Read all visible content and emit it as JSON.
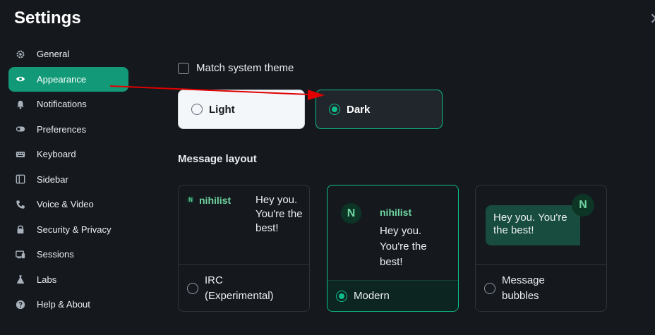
{
  "title": "Settings",
  "close_icon": "close-icon",
  "sidebar": {
    "items": [
      {
        "label": "General",
        "icon": "gear-icon"
      },
      {
        "label": "Appearance",
        "icon": "eye-icon",
        "active": true
      },
      {
        "label": "Notifications",
        "icon": "bell-icon"
      },
      {
        "label": "Preferences",
        "icon": "toggle-icon"
      },
      {
        "label": "Keyboard",
        "icon": "keyboard-icon"
      },
      {
        "label": "Sidebar",
        "icon": "sidebar-icon"
      },
      {
        "label": "Voice & Video",
        "icon": "phone-icon"
      },
      {
        "label": "Security & Privacy",
        "icon": "lock-icon"
      },
      {
        "label": "Sessions",
        "icon": "devices-icon"
      },
      {
        "label": "Labs",
        "icon": "flask-icon"
      },
      {
        "label": "Help & About",
        "icon": "help-icon"
      }
    ]
  },
  "appearance": {
    "match_system_theme": {
      "label": "Match system theme",
      "checked": false
    },
    "themes": [
      {
        "label": "Light",
        "selected": false
      },
      {
        "label": "Dark",
        "selected": true
      }
    ],
    "message_layout": {
      "title": "Message layout",
      "sender": "nihilist",
      "avatar_letter": "N",
      "message": "Hey you. You're the best!",
      "options": [
        {
          "label": "IRC (Experimental)",
          "selected": false
        },
        {
          "label": "Modern",
          "selected": true
        },
        {
          "label": "Message bubbles",
          "selected": false
        }
      ]
    }
  },
  "colors": {
    "accent": "#0dbd8b",
    "active_nav": "#129a78",
    "background": "#15191e",
    "annotation_arrow": "#e00000"
  }
}
